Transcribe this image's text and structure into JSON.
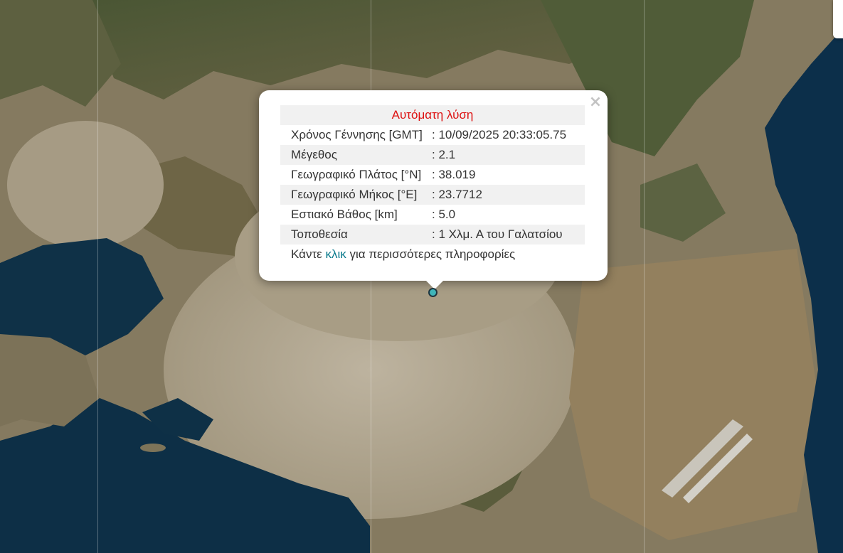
{
  "map": {
    "background": "satellite imagery",
    "colors": {
      "sea": "#0d3046",
      "land": "#8a7f66",
      "urban": "#b1a894",
      "vegetation": "#4f5b37",
      "popup_title": "#dd1111",
      "link": "#0a7a8c",
      "marker": "#3fb5b9"
    }
  },
  "popup": {
    "title": "Αυτόματη λύση",
    "close_symbol": "×",
    "rows": [
      {
        "label": "Χρόνος Γέννησης [GMT]",
        "value": ": 10/09/2025 20:33:05.75"
      },
      {
        "label": "Μέγεθος",
        "value": ": 2.1"
      },
      {
        "label": "Γεωγραφικό Πλάτος [°N]",
        "value": ": 38.019"
      },
      {
        "label": "Γεωγραφικό Μήκος [°E]",
        "value": ": 23.7712"
      },
      {
        "label": "Εστιακό Βάθος [km]",
        "value": ": 5.0"
      },
      {
        "label": "Τοποθεσία",
        "value": ": 1 Χλμ. Α του Γαλατσίου"
      }
    ],
    "footer": {
      "prefix": "Κάντε ",
      "link": "κλικ",
      "suffix": " για περισσότερες πληροφορίες"
    }
  },
  "marker": {
    "icon": "earthquake-marker"
  }
}
